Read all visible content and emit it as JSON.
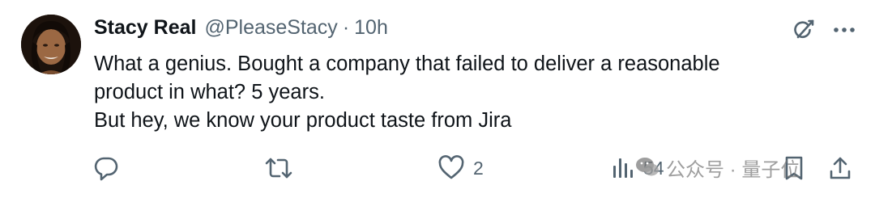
{
  "tweet": {
    "author_name": "Stacy Real",
    "author_handle": "@PleaseStacy",
    "separator": "·",
    "time": "10h",
    "lines": [
      "What a genius. Bought a company that failed to deliver a reasonable",
      "product in what? 5 years.",
      "But hey, we know your product taste from Jira"
    ]
  },
  "actions": {
    "likes": "2",
    "views": "54"
  },
  "icons": {
    "top": [
      "grok-icon",
      "more-icon"
    ],
    "bottom": [
      "reply-icon",
      "retweet-icon",
      "like-icon",
      "views-icon",
      "bookmark-icon",
      "share-icon"
    ]
  },
  "watermark": {
    "text": "公众号 · 量子位"
  },
  "colors": {
    "text_primary": "#0f1419",
    "text_secondary": "#536471"
  }
}
